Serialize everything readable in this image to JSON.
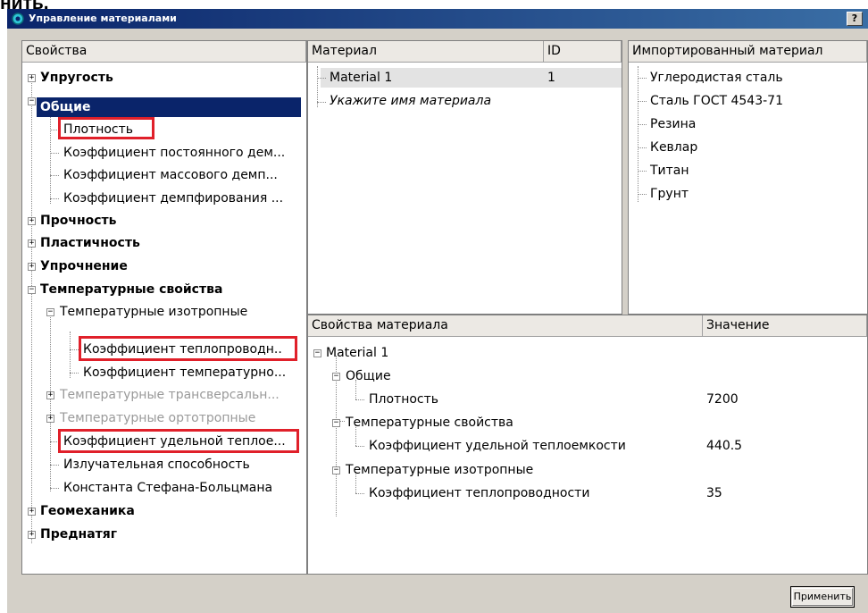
{
  "clip_text": "нить.",
  "window": {
    "title": "Управление материалами",
    "help_label": "?|×"
  },
  "left": {
    "header": "Свойства",
    "items": [
      {
        "label": "Упругость"
      },
      {
        "label": "Общие"
      },
      {
        "label": "Плотность"
      },
      {
        "label": "Коэффициент постоянного дем..."
      },
      {
        "label": "Коэффициент массового демп..."
      },
      {
        "label": "Коэффициент демпфирования ..."
      },
      {
        "label": "Прочность"
      },
      {
        "label": "Пластичность"
      },
      {
        "label": "Упрочнение"
      },
      {
        "label": "Температурные свойства"
      },
      {
        "label": "Температурные изотропные"
      },
      {
        "label": "Коэффициент теплопроводн.."
      },
      {
        "label": "Коэффициент температурно..."
      },
      {
        "label": "Температурные трансверсальн..."
      },
      {
        "label": "Температурные ортотропные"
      },
      {
        "label": "Коэффициент удельной теплое..."
      },
      {
        "label": "Излучательная способность"
      },
      {
        "label": "Константа Стефана-Больцмана"
      },
      {
        "label": "Геомеханика"
      },
      {
        "label": "Преднатяг"
      }
    ]
  },
  "materials": {
    "col_material": "Материал",
    "col_id": "ID",
    "rows": [
      {
        "name": "Material 1",
        "id": "1"
      }
    ],
    "placeholder": "Укажите имя материала"
  },
  "imported": {
    "header": "Импортированный материал",
    "items": [
      "Углеродистая сталь",
      "Сталь ГОСТ 4543-71",
      "Резина",
      "Кевлар",
      "Титан",
      "Грунт"
    ]
  },
  "props": {
    "col_prop": "Свойства материала",
    "col_value": "Значение",
    "root": "Material 1",
    "group_general": "Общие",
    "density_label": "Плотность",
    "density_value": "7200",
    "group_temp": "Температурные свойства",
    "heat_cap_label": "Коэффициент удельной теплоемкости",
    "heat_cap_value": "440.5",
    "group_iso": "Температурные изотропные",
    "conduct_label": "Коэффициент теплопроводности",
    "conduct_value": "35"
  },
  "apply_label": "Применить",
  "colors": {
    "selection": "#0a246a",
    "highlight_box": "#e0202a",
    "selected_row": "#e3e3e3"
  }
}
